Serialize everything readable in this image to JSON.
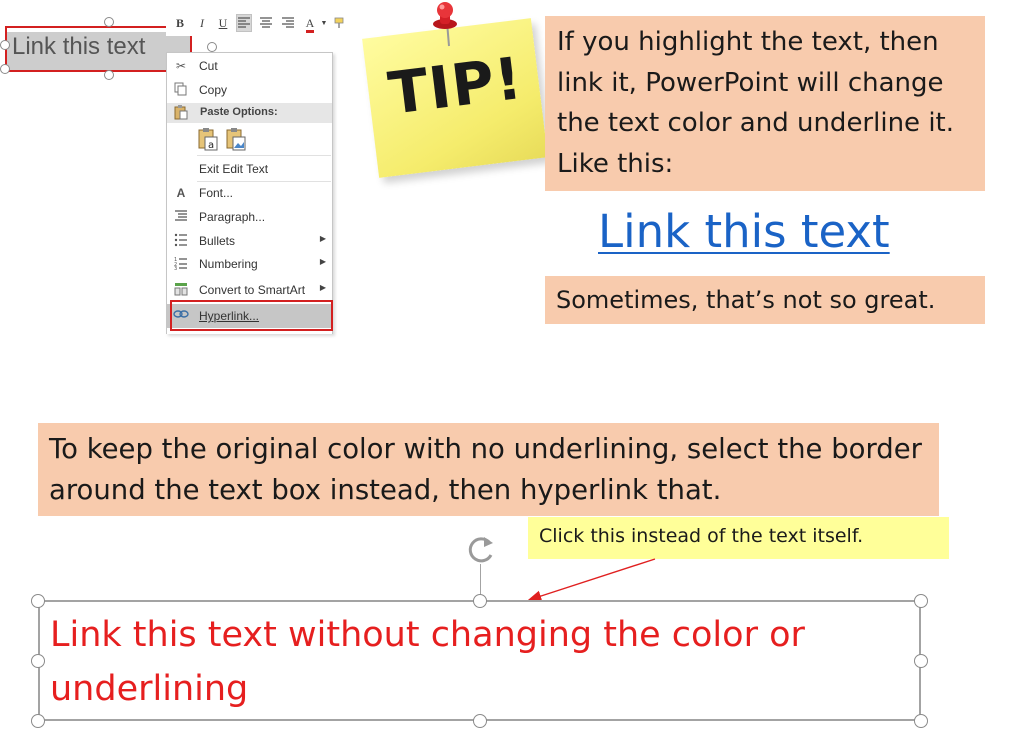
{
  "mini_toolbar": {
    "bold": "B",
    "italic": "I",
    "underline": "U",
    "font_color": "A",
    "icons": [
      "align-left-icon",
      "align-center-icon",
      "align-right-icon",
      "font-color-icon",
      "format-painter-icon"
    ]
  },
  "selected_text": "Link this text",
  "context_menu": {
    "cut": "Cut",
    "copy": "Copy",
    "paste_options": "Paste Options:",
    "exit_edit_text": "Exit Edit Text",
    "font": "Font...",
    "paragraph": "Paragraph...",
    "bullets": "Bullets",
    "numbering": "Numbering",
    "convert_to_smartart": "Convert to SmartArt",
    "hyperlink": "Hyperlink..."
  },
  "tip_note": {
    "text": "TIP!"
  },
  "tip_box": {
    "line1": "If you highlight the text, then",
    "line2": "link it, PowerPoint will change",
    "line3": "the text color and underline it.",
    "line4": "Like this:"
  },
  "sample_link": "Link this text",
  "warning_box": "Sometimes, that’s not so great.",
  "instruction_box": {
    "line1": "To keep the original color with no underlining, select the border",
    "line2": "around the text box instead, then hyperlink that."
  },
  "callout": "Click this instead of the text itself.",
  "example_box": {
    "line1": "Link this text without changing the color or",
    "line2": "underlining"
  },
  "colors": {
    "peach": "#f8cbad",
    "callout_yellow": "#ffff99",
    "link_blue": "#1a63c6",
    "example_red": "#e61f1f",
    "highlight_red": "#d32020"
  }
}
